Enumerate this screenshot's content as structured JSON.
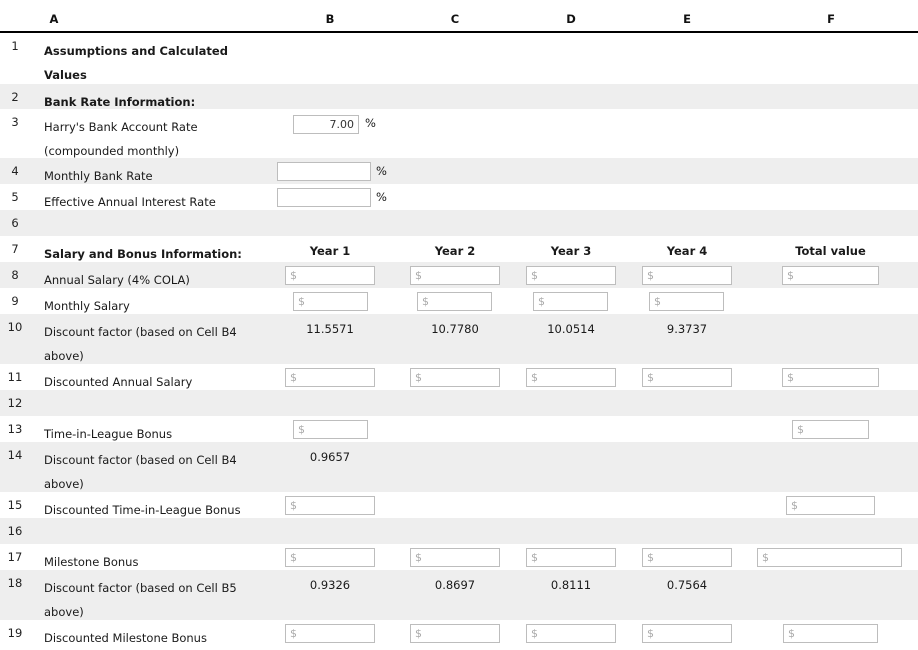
{
  "columns": [
    "A",
    "B",
    "C",
    "D",
    "E",
    "F"
  ],
  "theme": {
    "alt_row_bg": "#eeeeee",
    "row_bg": "#ffffff",
    "text": "#1a1a1a",
    "input_border": "#bdbdbd",
    "placeholder": "#aaaaaa"
  },
  "placeholders": {
    "dollar": "$",
    "blank": ""
  },
  "rows": {
    "r1": {
      "num": "1",
      "a": "Assumptions and Calculated\nValues"
    },
    "r2": {
      "num": "2",
      "a": "Bank Rate Information:"
    },
    "r3": {
      "num": "3",
      "a": "Harry's Bank Account Rate\n(compounded monthly)",
      "b_value": "7.00",
      "b_suffix": "%"
    },
    "r4": {
      "num": "4",
      "a": "Monthly Bank Rate",
      "b_value": "",
      "b_suffix": "%"
    },
    "r5": {
      "num": "5",
      "a": "Effective Annual Interest Rate",
      "b_value": "",
      "b_suffix": "%"
    },
    "r6": {
      "num": "6",
      "a": ""
    },
    "r7": {
      "num": "7",
      "a": "Salary and Bonus Information:",
      "b": "Year 1",
      "c": "Year 2",
      "d": "Year 3",
      "e": "Year 4",
      "f": "Total value"
    },
    "r8": {
      "num": "8",
      "a": "Annual Salary (4% COLA)",
      "b": "",
      "c": "",
      "d": "",
      "e": "",
      "f": ""
    },
    "r9": {
      "num": "9",
      "a": "Monthly Salary",
      "b": "",
      "c": "",
      "d": "",
      "e": ""
    },
    "r10": {
      "num": "10",
      "a": "Discount factor (based on Cell B4\nabove)",
      "b": "11.5571",
      "c": "10.7780",
      "d": "10.0514",
      "e": "9.3737"
    },
    "r11": {
      "num": "11",
      "a": "Discounted Annual Salary",
      "b": "",
      "c": "",
      "d": "",
      "e": "",
      "f": ""
    },
    "r12": {
      "num": "12",
      "a": ""
    },
    "r13": {
      "num": "13",
      "a": "Time-in-League Bonus",
      "b": "",
      "f": ""
    },
    "r14": {
      "num": "14",
      "a": "Discount factor (based on Cell B4\nabove)",
      "b": "0.9657"
    },
    "r15": {
      "num": "15",
      "a": "Discounted Time-in-League Bonus",
      "b": "",
      "f": ""
    },
    "r16": {
      "num": "16",
      "a": ""
    },
    "r17": {
      "num": "17",
      "a": "Milestone Bonus",
      "b": "",
      "c": "",
      "d": "",
      "e": "",
      "f": ""
    },
    "r18": {
      "num": "18",
      "a": "Discount factor (based on Cell B5\nabove)",
      "b": "0.9326",
      "c": "0.8697",
      "d": "0.8111",
      "e": "0.7564"
    },
    "r19": {
      "num": "19",
      "a": "Discounted Milestone Bonus",
      "b": "",
      "c": "",
      "d": "",
      "e": "",
      "f": ""
    }
  }
}
